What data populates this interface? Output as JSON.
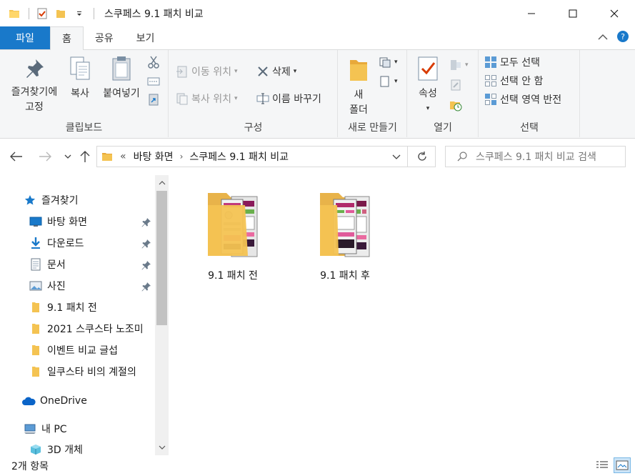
{
  "window": {
    "title": "스쿠페스 9.1 패치 비교",
    "controls": [
      "minimize",
      "maximize",
      "close"
    ]
  },
  "ribbon_tabs": [
    {
      "label": "파일"
    },
    {
      "label": "홈"
    },
    {
      "label": "공유"
    },
    {
      "label": "보기"
    }
  ],
  "ribbon": {
    "clipboard": {
      "pin_label_1": "즐겨찾기에",
      "pin_label_2": "고정",
      "copy": "복사",
      "paste": "붙여넣기",
      "group": "클립보드"
    },
    "organize": {
      "move_to": "이동 위치",
      "copy_to": "복사 위치",
      "delete": "삭제",
      "rename": "이름 바꾸기",
      "group": "구성"
    },
    "new": {
      "new_folder_1": "새",
      "new_folder_2": "폴더",
      "group": "새로 만들기"
    },
    "open": {
      "properties": "속성",
      "group": "열기"
    },
    "select": {
      "select_all": "모두 선택",
      "select_none": "선택 안 함",
      "invert": "선택 영역 반전",
      "group": "선택"
    }
  },
  "address": {
    "overflow": "«",
    "crumbs": [
      "바탕 화면",
      "스쿠페스 9.1 패치 비교"
    ],
    "search_placeholder": "스쿠페스 9.1 패치 비교 검색"
  },
  "nav": {
    "quick_access": "즐겨찾기",
    "items": [
      {
        "label": "바탕 화면",
        "icon": "desktop-icon",
        "pinned": true
      },
      {
        "label": "다운로드",
        "icon": "download-icon",
        "pinned": true
      },
      {
        "label": "문서",
        "icon": "document-icon",
        "pinned": true
      },
      {
        "label": "사진",
        "icon": "picture-icon",
        "pinned": true
      },
      {
        "label": "9.1 패치 전",
        "icon": "folder-icon",
        "pinned": false
      },
      {
        "label": "2021 스쿠스타 노조미",
        "icon": "folder-icon",
        "pinned": false
      },
      {
        "label": "이벤트 비교 글섭",
        "icon": "folder-icon",
        "pinned": false
      },
      {
        "label": "일쿠스타 비의 계절의",
        "icon": "folder-icon",
        "pinned": false
      }
    ],
    "onedrive": "OneDrive",
    "this_pc": "내 PC",
    "objects_3d": "3D 개체"
  },
  "files": [
    {
      "label": "9.1 패치 전"
    },
    {
      "label": "9.1 패치 후"
    }
  ],
  "status": {
    "count": "2개 항목"
  },
  "colors": {
    "file_tab": "#1979ca",
    "folder": "#f4c352",
    "accent": "#0078d7"
  }
}
